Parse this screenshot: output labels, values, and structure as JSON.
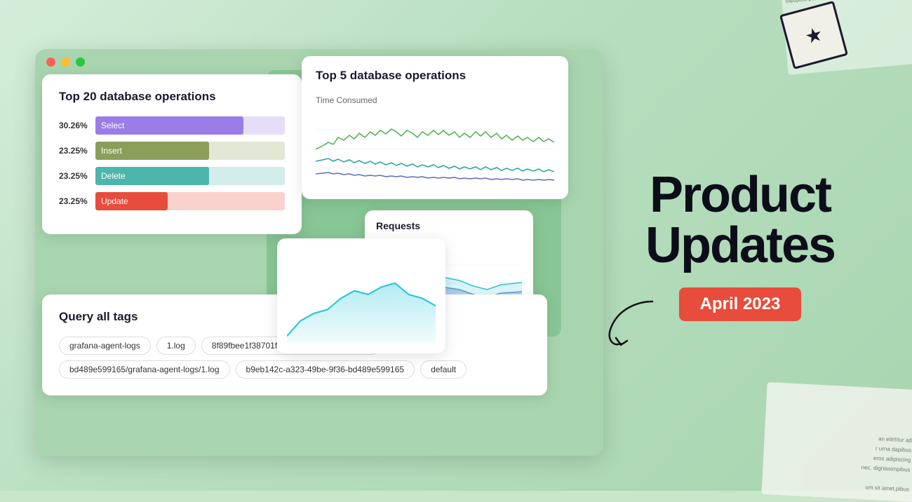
{
  "window": {
    "buttons": [
      "red",
      "yellow",
      "green"
    ]
  },
  "card_db_ops": {
    "title": "Top 20 database operations",
    "bars": [
      {
        "pct": "30.26%",
        "label": "Select",
        "color": "#9b7de8",
        "bg": "#e8e0f8",
        "width": "78%"
      },
      {
        "pct": "23.25%",
        "label": "Insert",
        "color": "#8b9e5a",
        "bg": "#e8eddb",
        "width": "60%"
      },
      {
        "pct": "23.25%",
        "label": "Delete",
        "color": "#4db6ac",
        "bg": "#d0efed",
        "width": "60%"
      },
      {
        "pct": "23.25%",
        "label": "Update",
        "color": "#e74c3c",
        "bg": "#fad7d4",
        "width": "38%"
      }
    ]
  },
  "card_top5": {
    "title": "Top 5 database operations",
    "subtitle": "Time Consumed"
  },
  "card_requests": {
    "title": "Requests"
  },
  "card_tags": {
    "title": "Query all tags",
    "tags": [
      "grafana-agent-logs",
      "1.log",
      "8f89fbee1f38701f158763b757650-json.log",
      "bd489e599165/grafana-agent-logs/1.log",
      "b9eb142c-a323-49be-9f36-bd489e599165",
      "default"
    ]
  },
  "product_updates": {
    "title_line1": "Product",
    "title_line2": "Updates",
    "date": "April 2023"
  }
}
